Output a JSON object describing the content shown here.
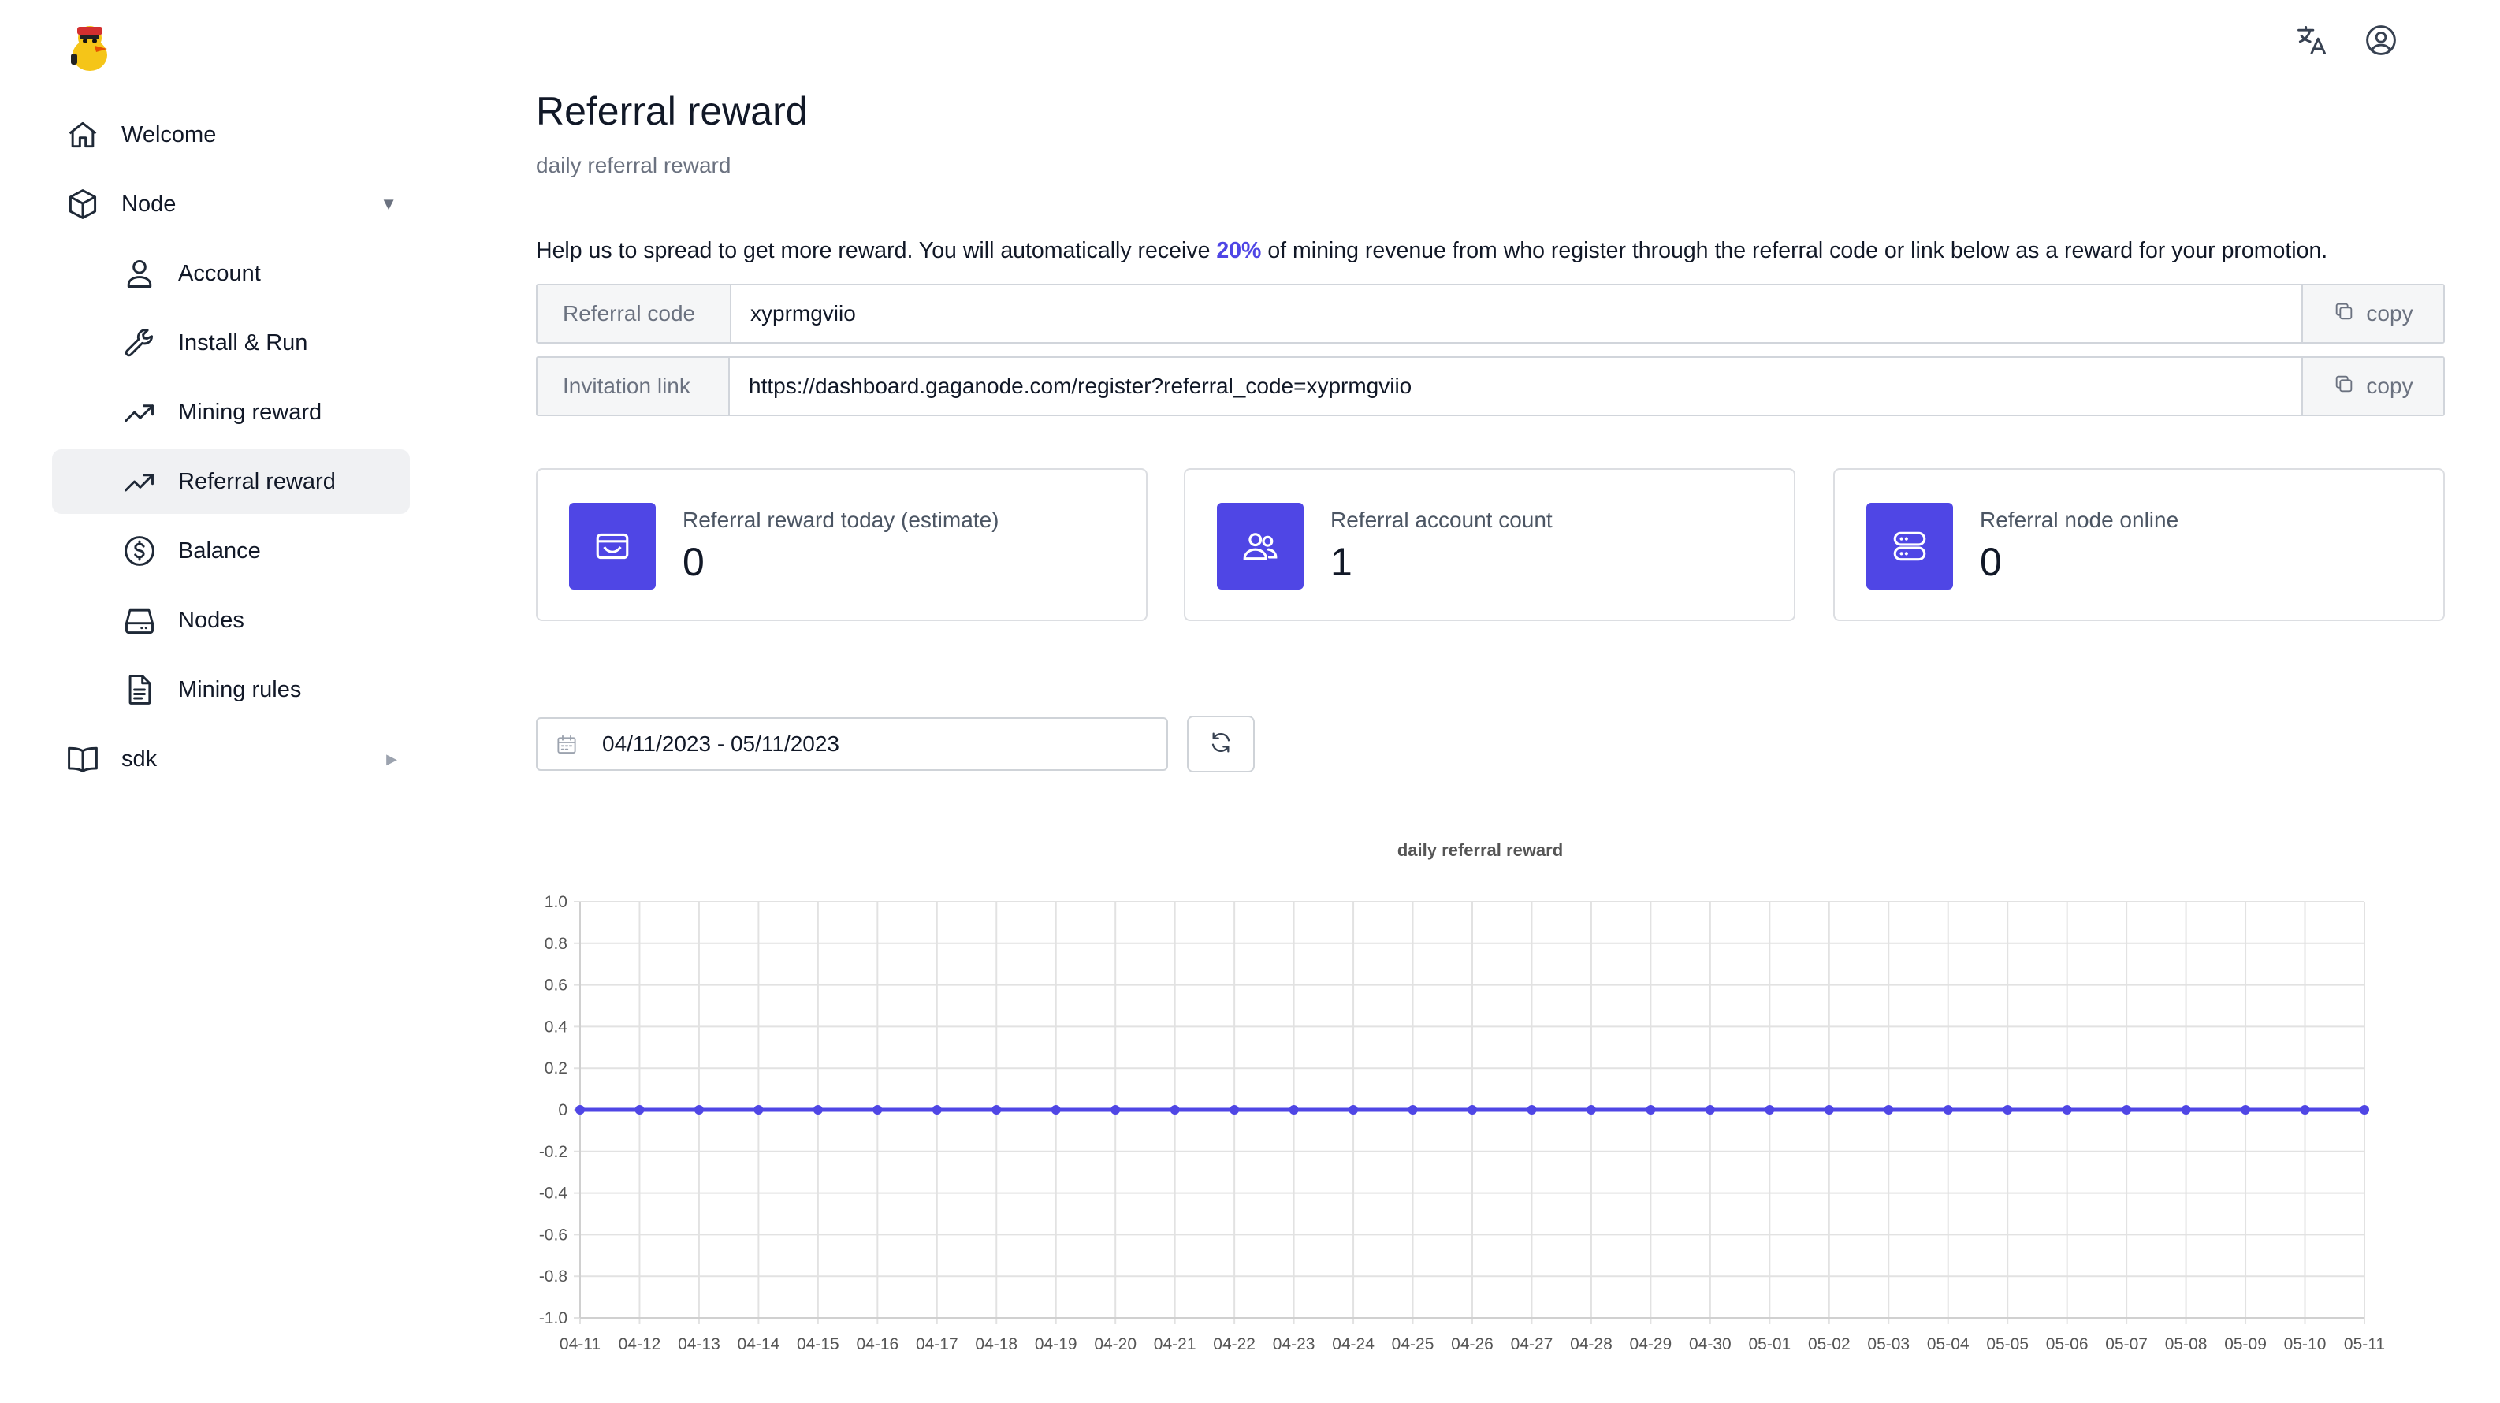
{
  "app": {
    "logo_icon": "duck-mascot-logo"
  },
  "topbar": {
    "translate_icon": "translate-icon",
    "user_icon": "user-circle-icon"
  },
  "sidebar": {
    "items": [
      {
        "label": "Welcome",
        "icon": "home-icon",
        "level": 1
      },
      {
        "label": "Node",
        "icon": "cube-icon",
        "level": 1,
        "expanded": true
      },
      {
        "label": "Account",
        "icon": "user-icon",
        "level": 2
      },
      {
        "label": "Install & Run",
        "icon": "wrench-icon",
        "level": 2
      },
      {
        "label": "Mining reward",
        "icon": "trend-up-icon",
        "level": 2
      },
      {
        "label": "Referral reward",
        "icon": "trend-up-icon",
        "level": 2,
        "active": true
      },
      {
        "label": "Balance",
        "icon": "dollar-circle-icon",
        "level": 2
      },
      {
        "label": "Nodes",
        "icon": "server-icon",
        "level": 2
      },
      {
        "label": "Mining rules",
        "icon": "document-icon",
        "level": 2
      },
      {
        "label": "sdk",
        "icon": "book-icon",
        "level": 1,
        "expanded": false
      }
    ]
  },
  "page": {
    "title": "Referral reward",
    "subtitle": "daily referral reward",
    "help_prefix": "Help us to spread to get more reward. You will automatically receive ",
    "help_percent": "20%",
    "help_suffix": " of mining revenue from who register through the referral code or link below as a reward for your promotion."
  },
  "referral_code": {
    "label": "Referral code",
    "value": "xyprmgviio",
    "copy_label": "copy"
  },
  "invitation_link": {
    "label": "Invitation link",
    "value": "https://dashboard.gaganode.com/register?referral_code=xyprmgviio",
    "copy_label": "copy"
  },
  "stats": [
    {
      "label": "Referral reward today (estimate)",
      "value": "0",
      "icon": "wallet-icon"
    },
    {
      "label": "Referral account count",
      "value": "1",
      "icon": "users-icon"
    },
    {
      "label": "Referral node online",
      "value": "0",
      "icon": "server-stack-icon"
    }
  ],
  "date_range": {
    "value": "04/11/2023 - 05/11/2023",
    "icon": "calendar-icon",
    "refresh_icon": "refresh-icon"
  },
  "colors": {
    "accent": "#4f46e5",
    "line": "#4f46e5"
  },
  "chart_data": {
    "type": "line",
    "title": "daily referral reward",
    "xlabel": "",
    "ylabel": "",
    "ylim": [
      -1.0,
      1.0
    ],
    "yticks": [
      "1.0",
      "0.8",
      "0.6",
      "0.4",
      "0.2",
      "0",
      "-0.2",
      "-0.4",
      "-0.6",
      "-0.8",
      "-1.0"
    ],
    "grid": true,
    "categories": [
      "04-11",
      "04-12",
      "04-13",
      "04-14",
      "04-15",
      "04-16",
      "04-17",
      "04-18",
      "04-19",
      "04-20",
      "04-21",
      "04-22",
      "04-23",
      "04-24",
      "04-25",
      "04-26",
      "04-27",
      "04-28",
      "04-29",
      "04-30",
      "05-01",
      "05-02",
      "05-03",
      "05-04",
      "05-05",
      "05-06",
      "05-07",
      "05-08",
      "05-09",
      "05-10",
      "05-11"
    ],
    "series": [
      {
        "values": [
          0,
          0,
          0,
          0,
          0,
          0,
          0,
          0,
          0,
          0,
          0,
          0,
          0,
          0,
          0,
          0,
          0,
          0,
          0,
          0,
          0,
          0,
          0,
          0,
          0,
          0,
          0,
          0,
          0,
          0,
          0
        ]
      }
    ]
  }
}
